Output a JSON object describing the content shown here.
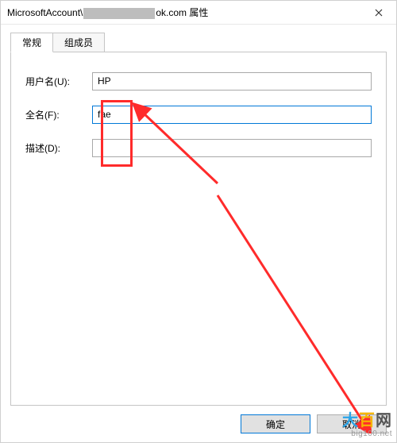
{
  "title": {
    "prefix": "MicrosoftAccount\\",
    "suffix": "ok.com 属性"
  },
  "tabs": {
    "general": "常规",
    "members": "组成员"
  },
  "form": {
    "username_label": "用户名(U):",
    "username_value": "HP",
    "fullname_label": "全名(F):",
    "fullname_value": "fae",
    "description_label": "描述(D):",
    "description_value": ""
  },
  "buttons": {
    "ok": "确定",
    "cancel": "取消"
  },
  "watermark": {
    "main": "大百网",
    "sub": "big100.net"
  },
  "colors": {
    "highlight": "#ff2b2b",
    "focus_border": "#0078d7"
  }
}
